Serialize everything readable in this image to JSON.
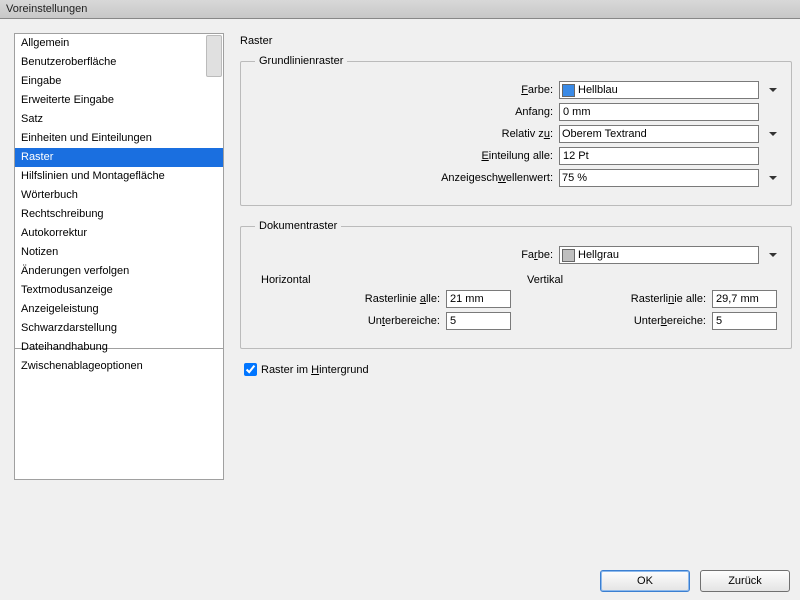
{
  "window": {
    "title": "Voreinstellungen"
  },
  "sidebar": {
    "items": [
      {
        "label": "Allgemein",
        "selected": false
      },
      {
        "label": "Benutzeroberfläche",
        "selected": false
      },
      {
        "label": "Eingabe",
        "selected": false
      },
      {
        "label": "Erweiterte Eingabe",
        "selected": false
      },
      {
        "label": "Satz",
        "selected": false
      },
      {
        "label": "Einheiten und Einteilungen",
        "selected": false
      },
      {
        "label": "Raster",
        "selected": true
      },
      {
        "label": "Hilfslinien und Montagefläche",
        "selected": false
      },
      {
        "label": "Wörterbuch",
        "selected": false
      },
      {
        "label": "Rechtschreibung",
        "selected": false
      },
      {
        "label": "Autokorrektur",
        "selected": false
      },
      {
        "label": "Notizen",
        "selected": false
      },
      {
        "label": "Änderungen verfolgen",
        "selected": false
      },
      {
        "label": "Textmodusanzeige",
        "selected": false
      },
      {
        "label": "Anzeigeleistung",
        "selected": false
      },
      {
        "label": "Schwarzdarstellung",
        "selected": false
      },
      {
        "label": "Dateihandhabung",
        "selected": false
      },
      {
        "label": "Zwischenablageoptionen",
        "selected": false
      }
    ]
  },
  "panel": {
    "title": "Raster",
    "baseline": {
      "legend": "Grundlinienraster",
      "color_label": "Farbe:",
      "color_value": "Hellblau",
      "color_hex": "#3a8ae6",
      "start_label": "Anfang:",
      "start_value": "0 mm",
      "relative_label": "Relativ zu:",
      "relative_value": "Oberem Textrand",
      "increment_label": "Einteilung alle:",
      "increment_value": "12 Pt",
      "threshold_label": "Anzeigeschwellenwert:",
      "threshold_value": "75 %"
    },
    "document": {
      "legend": "Dokumentraster",
      "color_label": "Farbe:",
      "color_value": "Hellgrau",
      "color_hex": "#bfbfbf",
      "horizontal_label": "Horizontal",
      "vertical_label": "Vertikal",
      "gridline_label": "Rasterlinie alle:",
      "subdiv_label": "Unterbereiche:",
      "h_gridline": "21 mm",
      "h_subdiv": "5",
      "v_gridline": "29,7 mm",
      "v_subdiv": "5"
    },
    "grids_back_checked": true,
    "grids_back_pre": "Raster im ",
    "grids_back_u": "H",
    "grids_back_post": "intergrund"
  },
  "buttons": {
    "ok": "OK",
    "back": "Zurück"
  }
}
